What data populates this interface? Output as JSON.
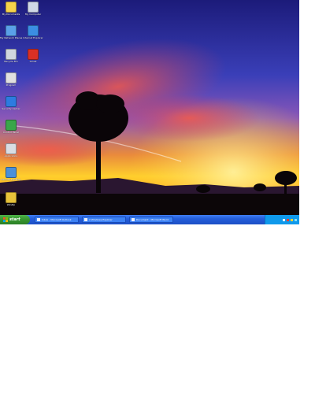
{
  "desktop": {
    "icons": [
      {
        "name": "my-documents-icon",
        "label": "My Documents",
        "color": "#f5d34a"
      },
      {
        "name": "my-computer-icon",
        "label": "My Computer",
        "color": "#cfd8e6"
      },
      {
        "name": "network-places-icon",
        "label": "My Network Places",
        "color": "#5aa0e8"
      },
      {
        "name": "internet-explorer-icon",
        "label": "Internet Explorer",
        "color": "#3b8ee3"
      },
      {
        "name": "recycle-bin-icon",
        "label": "Recycle Bin",
        "color": "#d0d6de"
      },
      {
        "name": "gmail-icon",
        "label": "Gmail",
        "color": "#d93025"
      },
      {
        "name": "program-shortcut-icon",
        "label": "Program",
        "color": "#e0e0e0"
      },
      {
        "name": "security-center-icon",
        "label": "Security Center",
        "color": "#2d7be0"
      },
      {
        "name": "control-panel-icon",
        "label": "Control Panel",
        "color": "#3aa64a"
      },
      {
        "name": "application-icon",
        "label": "Application",
        "color": "#d9dde3"
      },
      {
        "name": "remote-desktop-icon",
        "label": "Remote Desktop",
        "color": "#4a90d9"
      },
      {
        "name": "winzip-icon",
        "label": "WinZip",
        "color": "#e8c33a"
      }
    ]
  },
  "taskbar": {
    "start_label": "start",
    "tasks": [
      {
        "label": "Inbox - Microsoft Outlook"
      },
      {
        "label": "2 Windows Explorer"
      },
      {
        "label": "Document - Microsoft Word"
      }
    ],
    "tray_colors": [
      "#ffffff",
      "#ff3b30",
      "#ffd33a",
      "#7ee0ff"
    ]
  }
}
